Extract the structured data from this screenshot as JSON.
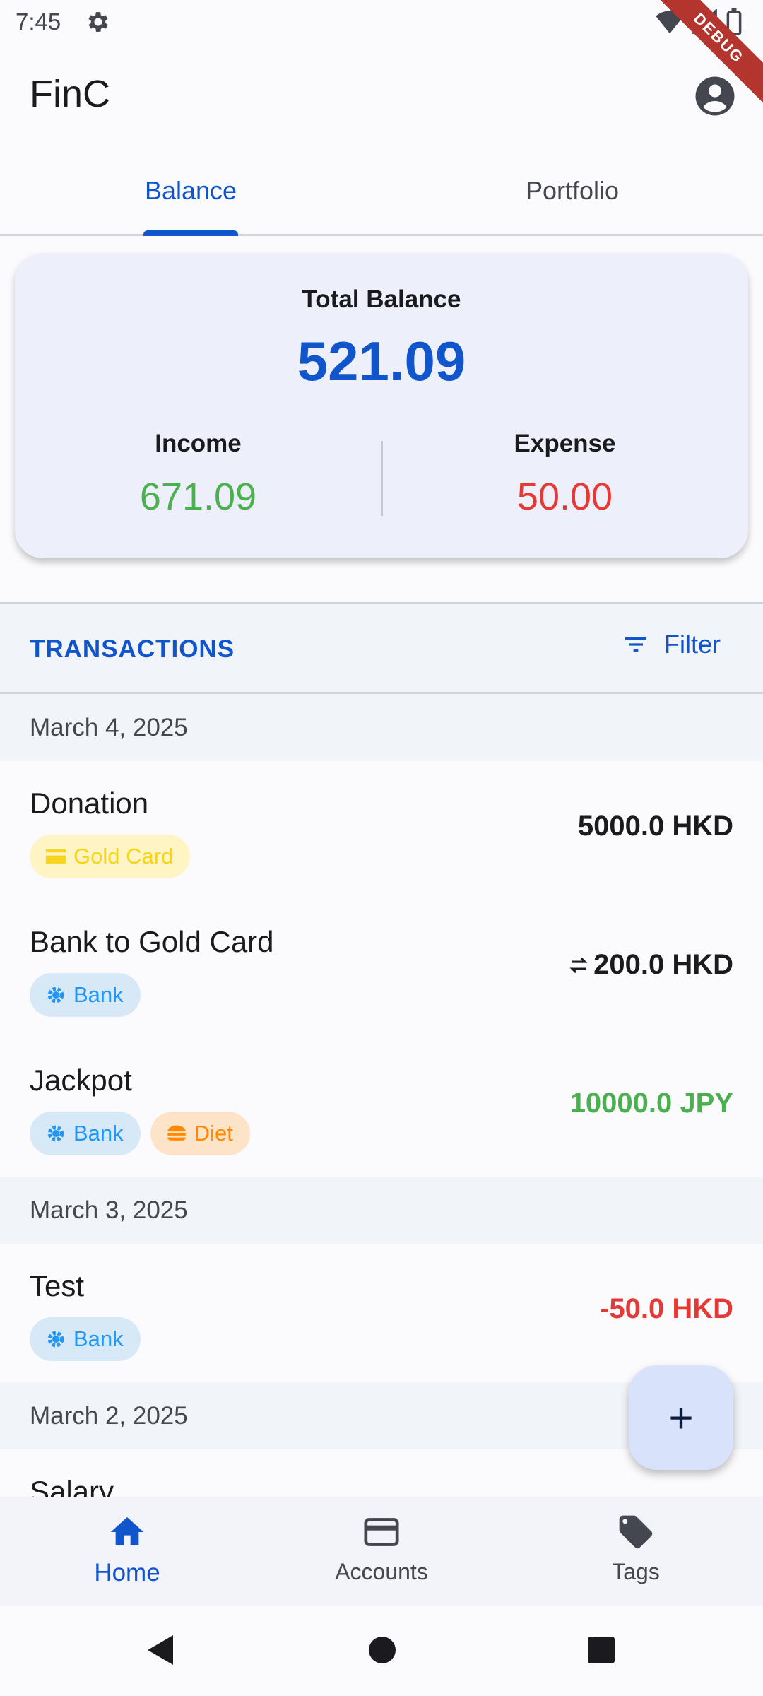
{
  "status_bar": {
    "time": "7:45",
    "debug_label": "DEBUG"
  },
  "app": {
    "title": "FinC"
  },
  "tabs": [
    {
      "label": "Balance",
      "active": true
    },
    {
      "label": "Portfolio",
      "active": false
    }
  ],
  "balance": {
    "total_label": "Total Balance",
    "total_value": "521.09",
    "income_label": "Income",
    "income_value": "671.09",
    "expense_label": "Expense",
    "expense_value": "50.00"
  },
  "transactions": {
    "title": "TRANSACTIONS",
    "filter_label": "Filter",
    "groups": [
      {
        "date": "March 4, 2025",
        "items": [
          {
            "name": "Donation",
            "chips": [
              {
                "label": "Gold Card",
                "type": "gold",
                "icon": "credit-card-icon"
              }
            ],
            "amount": "5000.0 HKD",
            "kind": "neutral"
          },
          {
            "name": "Bank to Gold Card",
            "chips": [
              {
                "label": "Bank",
                "type": "bank",
                "icon": "bank-gear-icon"
              }
            ],
            "amount": "200.0 HKD",
            "kind": "transfer"
          },
          {
            "name": "Jackpot",
            "chips": [
              {
                "label": "Bank",
                "type": "bank",
                "icon": "bank-gear-icon"
              },
              {
                "label": "Diet",
                "type": "diet",
                "icon": "burger-icon"
              }
            ],
            "amount": "10000.0 JPY",
            "kind": "income"
          }
        ]
      },
      {
        "date": "March 3, 2025",
        "items": [
          {
            "name": "Test",
            "chips": [
              {
                "label": "Bank",
                "type": "bank",
                "icon": "bank-gear-icon"
              }
            ],
            "amount": "-50.0 HKD",
            "kind": "expense"
          }
        ]
      },
      {
        "date": "March 2, 2025",
        "items": [
          {
            "name": "Salary",
            "chips": [],
            "amount": "",
            "kind": "neutral"
          }
        ]
      }
    ]
  },
  "fab": {
    "label": "+"
  },
  "bottom_nav": [
    {
      "label": "Home",
      "icon": "home-icon",
      "active": true
    },
    {
      "label": "Accounts",
      "icon": "credit-card-icon",
      "active": false
    },
    {
      "label": "Tags",
      "icon": "tag-icon",
      "active": false
    }
  ],
  "colors": {
    "primary": "#1155cc",
    "income": "#4caf50",
    "expense": "#e53935"
  }
}
